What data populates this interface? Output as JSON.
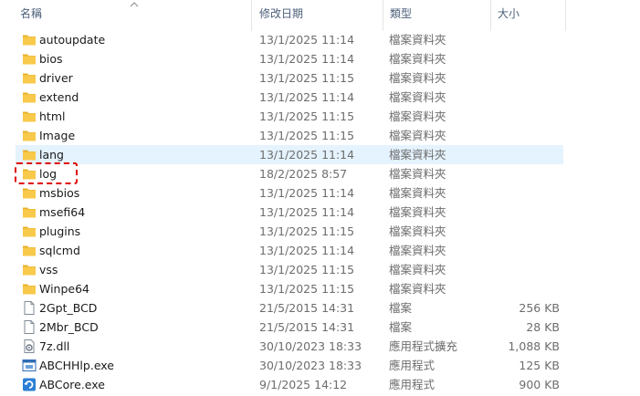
{
  "columns": {
    "name": "名稱",
    "date": "修改日期",
    "type": "類型",
    "size": "大小"
  },
  "files": [
    {
      "name": "autoupdate",
      "date": "13/1/2025 11:14",
      "type": "檔案資料夾",
      "size": "",
      "icon": "folder-icon"
    },
    {
      "name": "bios",
      "date": "13/1/2025 11:14",
      "type": "檔案資料夾",
      "size": "",
      "icon": "folder-icon"
    },
    {
      "name": "driver",
      "date": "13/1/2025 11:15",
      "type": "檔案資料夾",
      "size": "",
      "icon": "folder-icon"
    },
    {
      "name": "extend",
      "date": "13/1/2025 11:14",
      "type": "檔案資料夾",
      "size": "",
      "icon": "folder-icon"
    },
    {
      "name": "html",
      "date": "13/1/2025 11:15",
      "type": "檔案資料夾",
      "size": "",
      "icon": "folder-icon"
    },
    {
      "name": "Image",
      "date": "13/1/2025 11:15",
      "type": "檔案資料夾",
      "size": "",
      "icon": "folder-icon"
    },
    {
      "name": "lang",
      "date": "13/1/2025 11:14",
      "type": "檔案資料夾",
      "size": "",
      "icon": "folder-icon"
    },
    {
      "name": "log",
      "date": "18/2/2025 8:57",
      "type": "檔案資料夾",
      "size": "",
      "icon": "folder-icon"
    },
    {
      "name": "msbios",
      "date": "13/1/2025 11:14",
      "type": "檔案資料夾",
      "size": "",
      "icon": "folder-icon"
    },
    {
      "name": "msefi64",
      "date": "13/1/2025 11:14",
      "type": "檔案資料夾",
      "size": "",
      "icon": "folder-icon"
    },
    {
      "name": "plugins",
      "date": "13/1/2025 11:15",
      "type": "檔案資料夾",
      "size": "",
      "icon": "folder-icon"
    },
    {
      "name": "sqlcmd",
      "date": "13/1/2025 11:14",
      "type": "檔案資料夾",
      "size": "",
      "icon": "folder-icon"
    },
    {
      "name": "vss",
      "date": "13/1/2025 11:15",
      "type": "檔案資料夾",
      "size": "",
      "icon": "folder-icon"
    },
    {
      "name": "Winpe64",
      "date": "13/1/2025 11:15",
      "type": "檔案資料夾",
      "size": "",
      "icon": "folder-icon"
    },
    {
      "name": "2Gpt_BCD",
      "date": "21/5/2015 14:31",
      "type": "檔案",
      "size": "256 KB",
      "icon": "file-icon"
    },
    {
      "name": "2Mbr_BCD",
      "date": "21/5/2015 14:31",
      "type": "檔案",
      "size": "28 KB",
      "icon": "file-icon"
    },
    {
      "name": "7z.dll",
      "date": "30/10/2023 18:33",
      "type": "應用程式擴充",
      "size": "1,088 KB",
      "icon": "dll-icon"
    },
    {
      "name": "ABCHHlp.exe",
      "date": "30/10/2023 18:33",
      "type": "應用程式",
      "size": "125 KB",
      "icon": "exe-icon"
    },
    {
      "name": "ABCore.exe",
      "date": "9/1/2025 14:12",
      "type": "應用程式",
      "size": "900 KB",
      "icon": "abcore-exe-icon"
    }
  ],
  "hover_row": "lang",
  "highlighted_row": "log",
  "colors": {
    "folder": "#f8c94a",
    "hover": "#e5f3ff",
    "highlight_border": "#e00000",
    "header_text": "#4c607a"
  }
}
